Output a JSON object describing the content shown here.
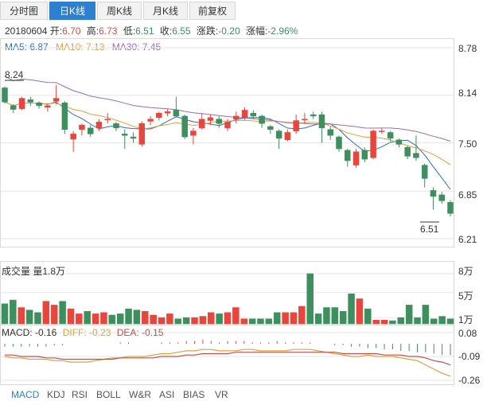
{
  "tabs": [
    {
      "label": "分时图",
      "active": false
    },
    {
      "label": "日K线",
      "active": true
    },
    {
      "label": "周K线",
      "active": false
    },
    {
      "label": "月K线",
      "active": false
    },
    {
      "label": "前复权",
      "active": false
    }
  ],
  "info": {
    "date": "20180604",
    "open_label": "开:",
    "open": "6.70",
    "high_label": "高:",
    "high": "6.73",
    "low_label": "低:",
    "low": "6.51",
    "close_label": "收:",
    "close": "6.55",
    "change_label": "涨跌:",
    "change": "-0.20",
    "pct_label": "涨幅:",
    "pct": "-2.96%"
  },
  "ma": [
    {
      "label": "MA5: 6.87",
      "color": "#2f6fb8"
    },
    {
      "label": "MA10: 7.13",
      "color": "#e0a040"
    },
    {
      "label": "MA30: 7.45",
      "color": "#9b6bb7"
    }
  ],
  "price_axis": [
    "8.78",
    "8.14",
    "7.50",
    "6.85",
    "6.21"
  ],
  "price_marks": {
    "high": "8.24",
    "low": "6.51"
  },
  "volume": {
    "title": "成交量 量1.8万",
    "axis": [
      "8万",
      "5万",
      "1万"
    ]
  },
  "macd": {
    "macd_label": "MACD: -0.16",
    "diff_label": "DIFF: -0.23",
    "dea_label": "DEA: -0.15",
    "macd_color": "#333333",
    "diff_color": "#e0a040",
    "dea_color": "#c0504d",
    "axis": [
      "0.08",
      "-0.09",
      "-0.26"
    ]
  },
  "indicators": [
    {
      "label": "MACD",
      "active": true
    },
    {
      "label": "KDJ",
      "active": false
    },
    {
      "label": "RSI",
      "active": false
    },
    {
      "label": "BOLL",
      "active": false
    },
    {
      "label": "W&R",
      "active": false
    },
    {
      "label": "ASI",
      "active": false
    },
    {
      "label": "BIAS",
      "active": false
    },
    {
      "label": "VR",
      "active": false
    }
  ],
  "colors": {
    "up": "#e8463c",
    "down": "#3e8f5e",
    "grid": "#e6e6e6"
  },
  "chart_data": {
    "type": "candlestick",
    "ylim": [
      6.21,
      8.78
    ],
    "candles": [
      [
        8.24,
        8.05,
        8.26,
        8.03
      ],
      [
        8.0,
        7.95,
        8.02,
        7.9
      ],
      [
        7.96,
        8.1,
        8.12,
        7.94
      ],
      [
        8.08,
        8.05,
        8.12,
        8.0
      ],
      [
        8.04,
        8.0,
        8.06,
        7.96
      ],
      [
        7.98,
        8.0,
        8.03,
        7.92
      ],
      [
        8.06,
        8.1,
        8.28,
        8.02
      ],
      [
        8.04,
        7.68,
        8.06,
        7.62
      ],
      [
        7.55,
        7.62,
        7.66,
        7.38
      ],
      [
        7.68,
        7.74,
        7.76,
        7.6
      ],
      [
        7.7,
        7.62,
        7.74,
        7.58
      ],
      [
        7.7,
        7.78,
        7.82,
        7.66
      ],
      [
        7.82,
        7.82,
        7.9,
        7.76
      ],
      [
        7.76,
        7.7,
        7.78,
        7.66
      ],
      [
        7.62,
        7.6,
        7.68,
        7.42
      ],
      [
        7.58,
        7.56,
        7.64,
        7.5
      ],
      [
        7.48,
        7.76,
        7.79,
        7.45
      ],
      [
        7.79,
        7.82,
        7.86,
        7.74
      ],
      [
        7.84,
        7.9,
        7.92,
        7.8
      ],
      [
        7.9,
        7.92,
        7.96,
        7.86
      ],
      [
        7.94,
        7.86,
        8.12,
        7.84
      ],
      [
        7.86,
        7.58,
        7.88,
        7.55
      ],
      [
        7.6,
        7.66,
        7.7,
        7.48
      ],
      [
        7.7,
        7.82,
        7.9,
        7.68
      ],
      [
        7.8,
        7.84,
        7.88,
        7.74
      ],
      [
        7.82,
        7.76,
        7.86,
        7.7
      ],
      [
        7.7,
        7.78,
        7.82,
        7.66
      ],
      [
        7.82,
        7.86,
        7.92,
        7.76
      ],
      [
        7.84,
        7.94,
        7.98,
        7.8
      ],
      [
        7.9,
        7.86,
        7.94,
        7.82
      ],
      [
        7.86,
        7.76,
        7.88,
        7.7
      ],
      [
        7.72,
        7.68,
        7.74,
        7.62
      ],
      [
        7.66,
        7.56,
        7.68,
        7.42
      ],
      [
        7.54,
        7.64,
        7.68,
        7.52
      ],
      [
        7.66,
        7.8,
        7.88,
        7.62
      ],
      [
        7.82,
        7.82,
        7.9,
        7.76
      ],
      [
        7.88,
        7.86,
        7.92,
        7.82
      ],
      [
        7.88,
        7.7,
        7.92,
        7.5
      ],
      [
        7.68,
        7.6,
        7.72,
        7.54
      ],
      [
        7.58,
        7.42,
        7.6,
        7.38
      ],
      [
        7.4,
        7.26,
        7.42,
        7.18
      ],
      [
        7.2,
        7.38,
        7.42,
        7.16
      ],
      [
        7.4,
        7.28,
        7.44,
        7.24
      ],
      [
        7.3,
        7.66,
        7.68,
        7.28
      ],
      [
        7.66,
        7.66,
        7.7,
        7.62
      ],
      [
        7.64,
        7.56,
        7.66,
        7.52
      ],
      [
        7.54,
        7.48,
        7.56,
        7.44
      ],
      [
        7.44,
        7.32,
        7.46,
        7.28
      ],
      [
        7.36,
        7.3,
        7.6,
        7.26
      ],
      [
        7.2,
        7.02,
        7.22,
        6.9
      ],
      [
        6.86,
        6.78,
        6.9,
        6.6
      ],
      [
        6.8,
        6.72,
        6.84,
        6.68
      ],
      [
        6.7,
        6.55,
        6.73,
        6.51
      ]
    ],
    "volume": [
      3.2,
      3.8,
      2.6,
      2.2,
      1.8,
      3.6,
      3.0,
      3.6,
      2.4,
      1.6,
      2.0,
      1.6,
      1.8,
      1.4,
      1.6,
      2.4,
      2.2,
      2.0,
      1.4,
      1.0,
      1.6,
      0.8,
      1.0,
      1.0,
      1.2,
      1.8,
      1.6,
      1.8,
      2.6,
      0.8,
      0.8,
      0.8,
      0.8,
      1.8,
      1.8,
      1.8,
      2.8,
      8.0,
      1.6,
      2.6,
      2.6,
      2.0,
      4.8,
      4.0,
      2.4,
      0.6,
      0.6,
      0.5,
      1.0,
      3.0,
      1.0,
      3.0,
      0.8,
      1.2,
      0.8
    ],
    "volume_ylim": [
      0,
      8.5
    ],
    "macd": {
      "ylim": [
        -0.26,
        0.08
      ],
      "hist": [
        -0.02,
        -0.02,
        -0.02,
        -0.02,
        -0.02,
        -0.02,
        -0.01,
        -0.01,
        0.0,
        0.0,
        0.0,
        0.0,
        0.0,
        0.0,
        0.01,
        0.01,
        0.0,
        0.0,
        0.0,
        0.01,
        0.01,
        0.01,
        0.02,
        0.02,
        0.03,
        0.02,
        0.01,
        0.02,
        0.02,
        0.02,
        0.01,
        0.01,
        0.01,
        0.02,
        0.01,
        0.01,
        0.01,
        0.01,
        0.0,
        0.0,
        -0.01,
        -0.01,
        -0.02,
        -0.02,
        -0.03,
        -0.03,
        -0.04,
        -0.04,
        -0.05,
        -0.05,
        -0.06,
        -0.06,
        -0.07,
        -0.08,
        -0.08
      ],
      "diff": [
        -0.09,
        -0.1,
        -0.1,
        -0.11,
        -0.11,
        -0.11,
        -0.12,
        -0.12,
        -0.13,
        -0.13,
        -0.13,
        -0.12,
        -0.11,
        -0.1,
        -0.1,
        -0.09,
        -0.09,
        -0.09,
        -0.08,
        -0.07,
        -0.07,
        -0.06,
        -0.05,
        -0.05,
        -0.04,
        -0.04,
        -0.05,
        -0.05,
        -0.05,
        -0.04,
        -0.04,
        -0.05,
        -0.05,
        -0.05,
        -0.05,
        -0.04,
        -0.04,
        -0.04,
        -0.05,
        -0.06,
        -0.07,
        -0.08,
        -0.09,
        -0.09,
        -0.08,
        -0.09,
        -0.09,
        -0.09,
        -0.1,
        -0.11,
        -0.12,
        -0.15,
        -0.18,
        -0.21,
        -0.23
      ],
      "dea": [
        -0.08,
        -0.08,
        -0.09,
        -0.09,
        -0.09,
        -0.1,
        -0.1,
        -0.11,
        -0.11,
        -0.11,
        -0.11,
        -0.11,
        -0.11,
        -0.11,
        -0.1,
        -0.1,
        -0.1,
        -0.1,
        -0.1,
        -0.09,
        -0.09,
        -0.09,
        -0.08,
        -0.08,
        -0.07,
        -0.07,
        -0.07,
        -0.07,
        -0.06,
        -0.06,
        -0.06,
        -0.06,
        -0.06,
        -0.06,
        -0.06,
        -0.06,
        -0.06,
        -0.06,
        -0.06,
        -0.06,
        -0.06,
        -0.07,
        -0.07,
        -0.07,
        -0.07,
        -0.07,
        -0.08,
        -0.08,
        -0.08,
        -0.09,
        -0.09,
        -0.1,
        -0.12,
        -0.13,
        -0.15
      ]
    }
  }
}
